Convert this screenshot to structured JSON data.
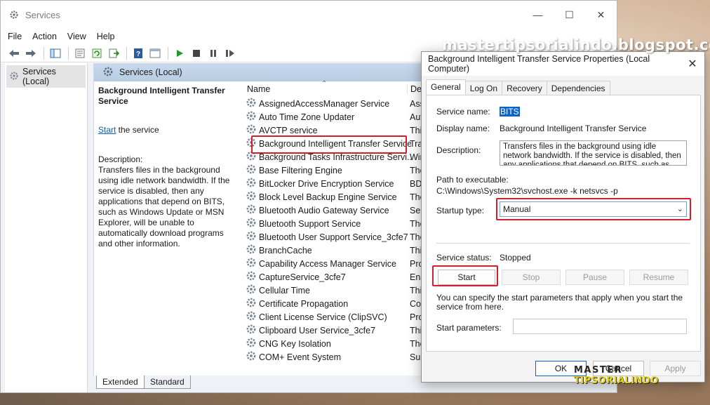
{
  "window": {
    "title": "Services",
    "controls": [
      "—",
      "☐",
      "✕"
    ]
  },
  "menu": [
    "File",
    "Action",
    "View",
    "Help"
  ],
  "tree": {
    "root_label": "Services (Local)"
  },
  "pane": {
    "header": "Services (Local)",
    "selected_service_title": "Background Intelligent Transfer Service",
    "start_link": "Start",
    "start_suffix": " the service",
    "description_label": "Description:",
    "description_text": "Transfers files in the background using idle network bandwidth. If the service is disabled, then any applications that depend on BITS, such as Windows Update or MSN Explorer, will be unable to automatically download programs and other information."
  },
  "list": {
    "columns": {
      "name": "Name",
      "description": "Des"
    },
    "rows": [
      {
        "name": "AssignedAccessManager Service",
        "desc": "Assi"
      },
      {
        "name": "Auto Time Zone Updater",
        "desc": "Auto"
      },
      {
        "name": "AVCTP service",
        "desc": "This"
      },
      {
        "name": "Background Intelligent Transfer Service",
        "desc": "Tran"
      },
      {
        "name": "Background Tasks Infrastructure Servi...",
        "desc": "Win"
      },
      {
        "name": "Base Filtering Engine",
        "desc": "The"
      },
      {
        "name": "BitLocker Drive Encryption Service",
        "desc": "BDE"
      },
      {
        "name": "Block Level Backup Engine Service",
        "desc": "The"
      },
      {
        "name": "Bluetooth Audio Gateway Service",
        "desc": "Serv"
      },
      {
        "name": "Bluetooth Support Service",
        "desc": "The"
      },
      {
        "name": "Bluetooth User Support Service_3cfe7",
        "desc": "The"
      },
      {
        "name": "BranchCache",
        "desc": "This"
      },
      {
        "name": "Capability Access Manager Service",
        "desc": "Pro"
      },
      {
        "name": "CaptureService_3cfe7",
        "desc": "Ena"
      },
      {
        "name": "Cellular Time",
        "desc": "This"
      },
      {
        "name": "Certificate Propagation",
        "desc": "Cop"
      },
      {
        "name": "Client License Service (ClipSVC)",
        "desc": "Pro"
      },
      {
        "name": "Clipboard User Service_3cfe7",
        "desc": "This"
      },
      {
        "name": "CNG Key Isolation",
        "desc": "The"
      },
      {
        "name": "COM+ Event System",
        "desc": "Sup"
      }
    ]
  },
  "bottom_tabs": [
    "Extended",
    "Standard"
  ],
  "dialog": {
    "title": "Background Intelligent Transfer Service Properties (Local Computer)",
    "close": "✕",
    "tabs": [
      "General",
      "Log On",
      "Recovery",
      "Dependencies"
    ],
    "service_name_label": "Service name:",
    "service_name": "BITS",
    "display_name_label": "Display name:",
    "display_name": "Background Intelligent Transfer Service",
    "description_label": "Description:",
    "description": "Transfers files in the background using idle network bandwidth. If the service is disabled, then any applications that depend on BITS, such as Windows",
    "path_label": "Path to executable:",
    "path": "C:\\Windows\\System32\\svchost.exe -k netsvcs -p",
    "startup_type_label": "Startup type:",
    "startup_type": "Manual",
    "service_status_label": "Service status:",
    "service_status": "Stopped",
    "buttons": {
      "start": "Start",
      "stop": "Stop",
      "pause": "Pause",
      "resume": "Resume"
    },
    "start_params_hint": "You can specify the start parameters that apply when you start the service from here.",
    "start_params_label": "Start parameters:",
    "footer": {
      "ok": "OK",
      "cancel": "Cancel",
      "apply": "Apply"
    }
  },
  "watermark": "mastertipsorialindo.blogspot.com",
  "logo": {
    "line1": "MASTER",
    "line2": "TIPSORIALINDO"
  },
  "colors": {
    "highlight": "#d21f2b",
    "selection": "#0a64c8",
    "link": "#0a58b8",
    "pane_header": "#c3d5ea"
  }
}
